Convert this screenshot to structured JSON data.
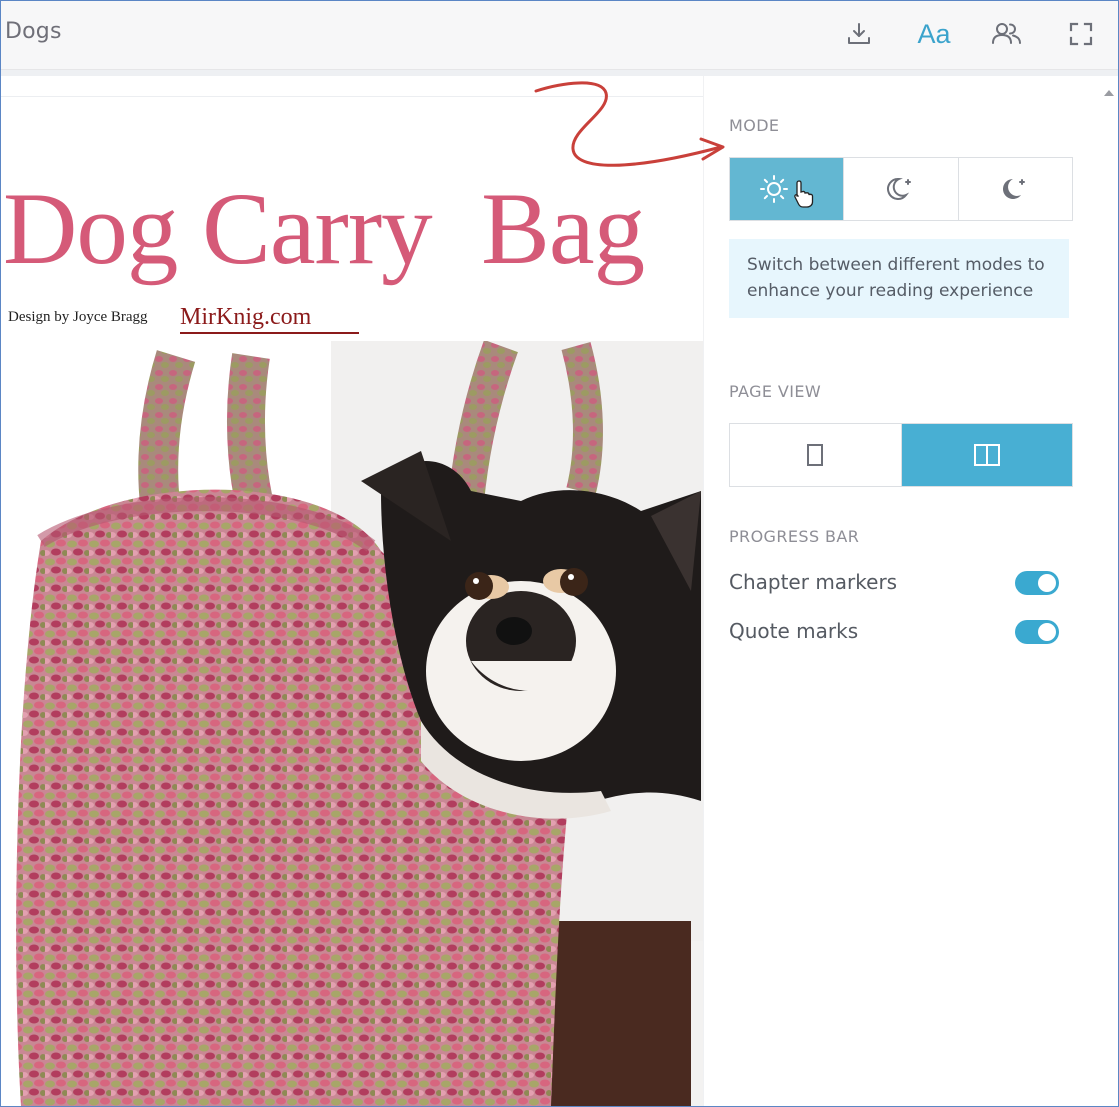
{
  "header": {
    "title": "Dogs",
    "icons": [
      "download-icon",
      "font-settings-icon",
      "users-icon",
      "fullscreen-icon"
    ],
    "font_button_label": "Aa"
  },
  "page": {
    "heading": "Dog Carry  Bag",
    "byline": "Design by Joyce Bragg",
    "watermark": "MirKnig.com"
  },
  "panel": {
    "mode": {
      "label": "MODE",
      "options": [
        "light",
        "dark",
        "night"
      ],
      "selected": "light"
    },
    "info_text": "Switch between different modes to enhance your reading experience",
    "page_view": {
      "label": "PAGE VIEW",
      "options": [
        "single-page",
        "two-page"
      ],
      "selected": "two-page"
    },
    "progress_bar": {
      "label": "PROGRESS BAR",
      "toggles": [
        {
          "label": "Chapter markers",
          "on": true
        },
        {
          "label": "Quote marks",
          "on": true
        }
      ]
    }
  },
  "colors": {
    "accent": "#48afd3",
    "heading": "#d55a78",
    "annotation_arrow": "#c9403a"
  }
}
